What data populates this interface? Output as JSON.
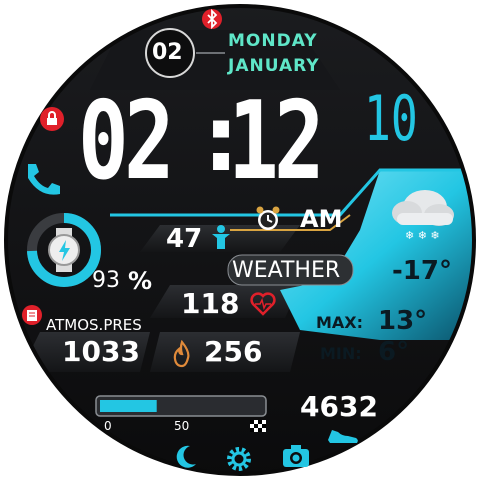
{
  "date": {
    "day_num": "02",
    "weekday": "MONDAY",
    "month": "JANUARY"
  },
  "time": {
    "hours": "02",
    "separator": ":",
    "minutes": "12",
    "seconds": "10",
    "ampm": "AM"
  },
  "battery": {
    "percent": "93",
    "unit": "%",
    "level": 0.93
  },
  "heart_steps_icon_value": "47",
  "heart_rate": "118",
  "weather": {
    "label": "WEATHER",
    "temp": "-17°",
    "max_label": "MAX:",
    "max": "13°",
    "min_label": "MIN:",
    "min": "6°"
  },
  "pressure": {
    "label_a": "ATMOS.",
    "label_b": "PRES",
    "value": "1033"
  },
  "calories": "256",
  "steps": "4632",
  "progress": {
    "level": 0.35,
    "tick_0": "0",
    "tick_50": "50"
  },
  "colors": {
    "accent": "#23c6e3",
    "red": "#e0202a",
    "mint": "#5fe6c8"
  },
  "icons": [
    "bluetooth-icon",
    "lock-icon",
    "phone-icon",
    "watch-battery-icon",
    "person-icon",
    "alarm-icon",
    "heart-icon",
    "cloud-snow-icon",
    "pressure-icon",
    "flame-icon",
    "shoe-icon",
    "moon-icon",
    "gear-icon",
    "camera-icon"
  ]
}
